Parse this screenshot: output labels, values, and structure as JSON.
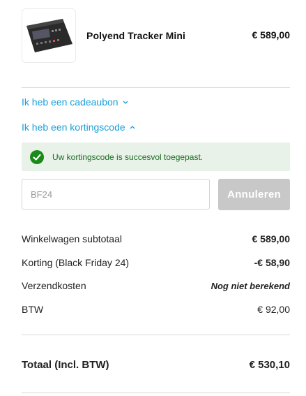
{
  "product": {
    "name": "Polyend Tracker Mini",
    "price": "€ 589,00"
  },
  "gift_card_link": "Ik heb een cadeaubon",
  "discount_link": "Ik heb een kortingscode",
  "success_message": "Uw kortingscode is succesvol toegepast.",
  "discount_input": {
    "value": "BF24"
  },
  "cancel_button": "Annuleren",
  "summary": [
    {
      "label": "Winkelwagen subtotaal",
      "value": "€ 589,00"
    },
    {
      "label": "Korting (Black Friday 24)",
      "value": "-€ 58,90"
    },
    {
      "label": "Verzendkosten",
      "value": "Nog niet berekend"
    },
    {
      "label": "BTW",
      "value": "€ 92,00"
    }
  ],
  "total": {
    "label": "Totaal (Incl. BTW)",
    "value": "€ 530,10"
  },
  "colors": {
    "link": "#1aa0d8",
    "success_bg": "#e8f2e8",
    "success_icon": "#1a8a1a",
    "button_disabled": "#c8c8c8"
  }
}
